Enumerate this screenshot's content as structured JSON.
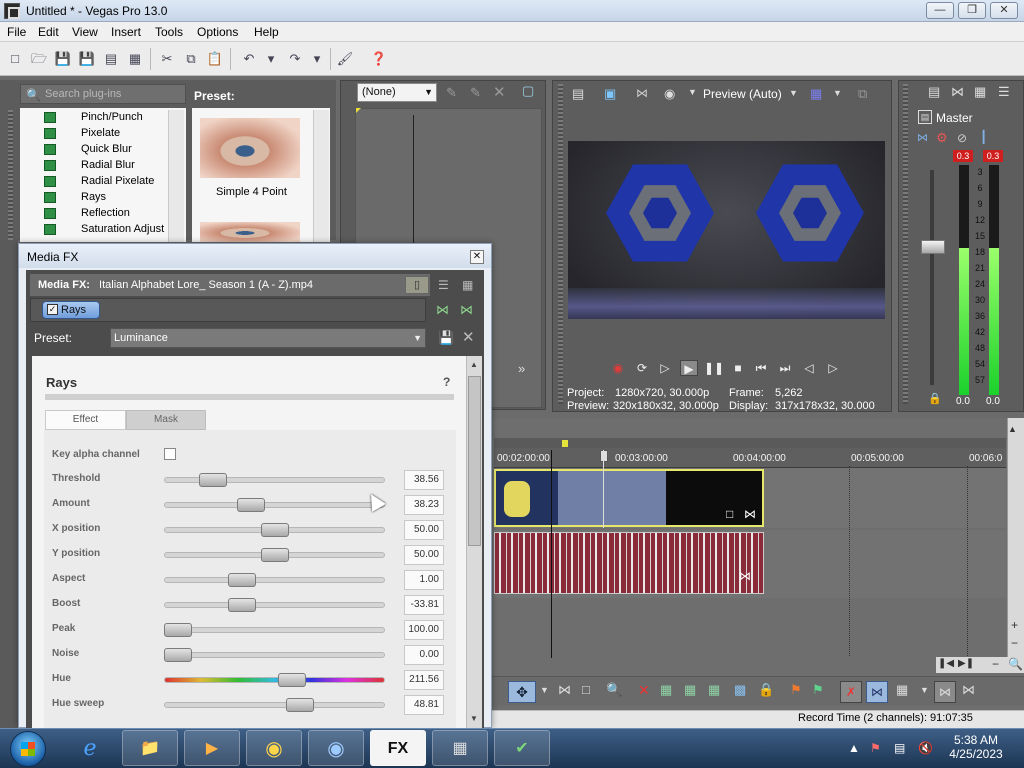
{
  "window": {
    "title": "Untitled * - Vegas Pro 13.0"
  },
  "menu": [
    "File",
    "Edit",
    "View",
    "Insert",
    "Tools",
    "Options",
    "Help"
  ],
  "plugins": {
    "search_placeholder": "Search plug-ins",
    "items": [
      "Pinch/Punch",
      "Pixelate",
      "Quick Blur",
      "Radial Blur",
      "Radial Pixelate",
      "Rays",
      "Reflection",
      "Saturation Adjust"
    ],
    "preset_header": "Preset:",
    "preset_name": "Simple 4 Point"
  },
  "fx_chooser": {
    "selected": "(None)"
  },
  "preview": {
    "mode": "Preview (Auto)",
    "project_label": "Project:",
    "project_value": "1280x720, 30.000p",
    "preview_label": "Preview:",
    "preview_value": "320x180x32, 30.000p",
    "frame_label": "Frame:",
    "frame_value": "5,262",
    "display_label": "Display:",
    "display_value": "317x178x32, 30.000"
  },
  "master": {
    "title": "Master",
    "peak_left": "0.3",
    "peak_right": "0.3",
    "level_left": "0.0",
    "level_right": "0.0",
    "scale": [
      "3",
      "6",
      "9",
      "12",
      "15",
      "18",
      "21",
      "24",
      "30",
      "36",
      "42",
      "48",
      "54",
      "57"
    ],
    "meter_fill_fraction": 0.64
  },
  "timeline": {
    "ruler": [
      "00:02:00:00",
      "00:03:00:00",
      "00:04:00:00",
      "00:05:00:00",
      "00:06:0"
    ],
    "record_time": "Record Time (2 channels): 91:07:35"
  },
  "media_fx": {
    "title": "Media FX",
    "head_label": "Media FX:",
    "head_value": "Italian Alphabet Lore_ Season 1 (A - Z).mp4",
    "chain_effect": "Rays",
    "preset_label": "Preset:",
    "preset_value": "Luminance",
    "panel_title": "Rays",
    "help": "?",
    "tab_effect": "Effect",
    "tab_mask": "Mask",
    "key_alpha_label": "Key alpha channel",
    "params": [
      {
        "label": "Threshold",
        "value": "38.56",
        "pos": 0.18
      },
      {
        "label": "Amount",
        "value": "38.23",
        "pos": 0.38
      },
      {
        "label": "X position",
        "value": "50.00",
        "pos": 0.5
      },
      {
        "label": "Y position",
        "value": "50.00",
        "pos": 0.5
      },
      {
        "label": "Aspect",
        "value": "1.00",
        "pos": 0.33
      },
      {
        "label": "Boost",
        "value": "-33.81",
        "pos": 0.33
      },
      {
        "label": "Peak",
        "value": "100.00",
        "pos": 0.0
      },
      {
        "label": "Noise",
        "value": "0.00",
        "pos": 0.0
      },
      {
        "label": "Hue",
        "value": "211.56",
        "pos": 0.59
      },
      {
        "label": "Hue sweep",
        "value": "48.81",
        "pos": 0.63
      }
    ]
  },
  "taskbar": {
    "time": "5:38 AM",
    "date": "4/25/2023"
  }
}
